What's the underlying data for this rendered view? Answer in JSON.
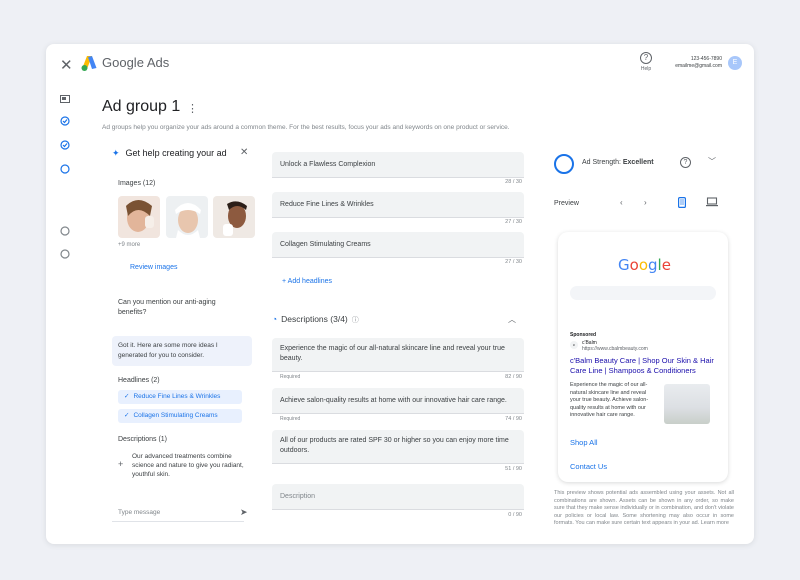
{
  "app": {
    "brand_name": "Google Ads",
    "help_label": "Help",
    "phone": "123-456-7890",
    "email": "emailme@gmail.com",
    "avatar_letter": "E"
  },
  "page": {
    "title": "Ad group 1",
    "subtitle": "Ad groups help you organize your ads around a common theme. For the best results, focus your ads and keywords on one product or service."
  },
  "assistant": {
    "header": "Get help creating your ad",
    "images_label": "Images (12)",
    "more_label": "+9 more",
    "review_label": "Review images",
    "question": "Can you mention our anti-aging benefits?",
    "answer": "Got it. Here are some more ideas I generated for you to consider.",
    "headlines_label": "Headlines (2)",
    "headlines": [
      "Reduce Fine Lines & Wrinkles",
      "Collagen Stimulating Creams"
    ],
    "descriptions_label": "Descriptions (1)",
    "description": "Our advanced treatments combine science and nature to give you radiant, youthful skin.",
    "message_placeholder": "Type message"
  },
  "headlines": {
    "items": [
      {
        "text": "Unlock a Flawless Complexion",
        "count": "28 / 30"
      },
      {
        "text": "Reduce Fine Lines & Wrinkles",
        "count": "27 / 30"
      },
      {
        "text": "Collagen Stimulating Creams",
        "count": "27 / 30"
      }
    ],
    "add_label": "Add headlines"
  },
  "descriptions": {
    "header": "Descriptions (3/4)",
    "items": [
      {
        "text": "Experience the magic of our all-natural skincare line and reveal your true beauty.",
        "required": "Required",
        "count": "82 / 90"
      },
      {
        "text": "Achieve salon-quality results at home with our innovative hair care range.",
        "required": "Required",
        "count": "74 / 90"
      },
      {
        "text": "All of our products are rated SPF 30 or higher so you can enjoy more time outdoors.",
        "required": "",
        "count": "51 / 90"
      },
      {
        "text": "",
        "placeholder": "Description",
        "required": "",
        "count": "0 / 90"
      }
    ]
  },
  "preview": {
    "strength_label": "Ad Strength:",
    "strength_value": "Excellent",
    "preview_label": "Preview",
    "google_logo": "Google",
    "sponsored": "Sponsored",
    "advertiser": "c'Balm",
    "advertiser_url": "https://www.cbalmbeauty.com",
    "ad_title": "c'Balm Beauty Care | Shop Our Skin & Hair Care Line | Shampoos & Conditioners",
    "ad_description": "Experience the magic of our all-natural skincare line and reveal your true beauty. Achieve salon-quality results at home with our innovative hair care range.",
    "sitelinks": [
      "Shop All",
      "Contact Us"
    ],
    "disclaimer": "This preview shows potential ads assembled using your assets. Not all combinations are shown. Assets can be shown in any order, so make sure that they make sense individually or in combination, and don't violate our policies or local law. Some shortening may also occur in some formats. You can make sure certain text appears in your ad. Learn more"
  },
  "colors": {
    "accent": "#1a73e8",
    "assistant_bubble": "#eef2fb",
    "field_bg": "#f1f3f4"
  }
}
